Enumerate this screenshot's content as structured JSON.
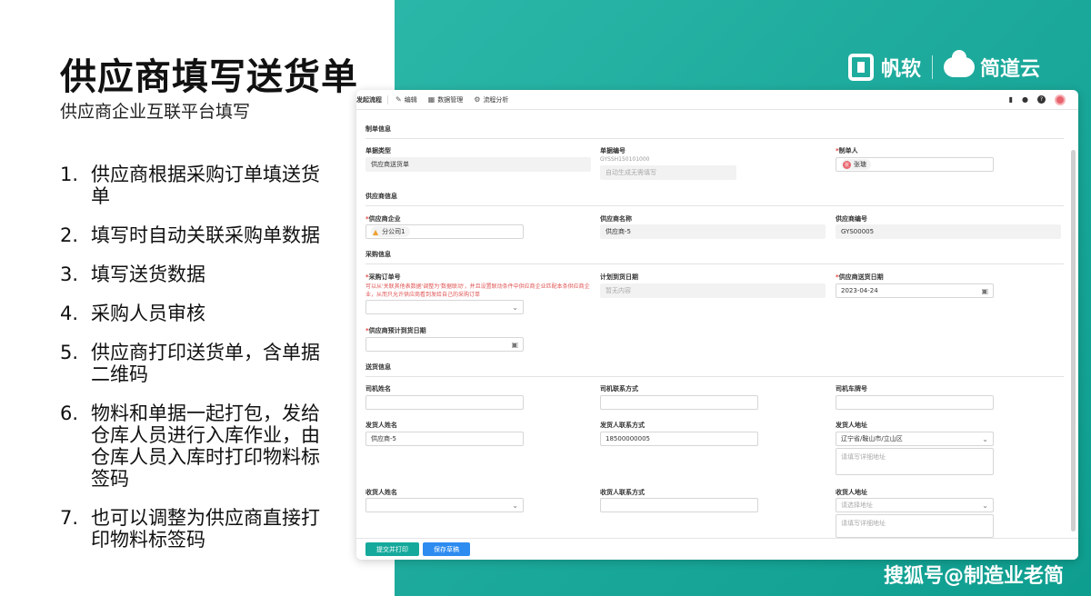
{
  "slide": {
    "title": "供应商填写送货单",
    "subtitle": "供应商企业互联平台填写",
    "steps": [
      {
        "num": "1.",
        "text": "供应商根据采购订单填送货单"
      },
      {
        "num": "2.",
        "text": "填写时自动关联采购单数据"
      },
      {
        "num": "3.",
        "text": "填写送货数据"
      },
      {
        "num": "4.",
        "text": "采购人员审核"
      },
      {
        "num": "5.",
        "text": "供应商打印送货单，含单据二维码"
      },
      {
        "num": "6.",
        "text": "物料和单据一起打包，发给仓库人员进行入库作业，由仓库人员入库时打印物料标签码"
      },
      {
        "num": "7.",
        "text": "也可以调整为供应商直接打印物料标签码"
      }
    ]
  },
  "brand": {
    "name1": "帆软",
    "name2": "简道云"
  },
  "watermark": "搜狐号@制造业老简",
  "toolbar": {
    "items": [
      "发起流程",
      "编辑",
      "数据管理",
      "流程分析"
    ],
    "help": "?"
  },
  "form": {
    "sections": {
      "doc": "制单信息",
      "supplier": "供应商信息",
      "purchase": "采购信息",
      "delivery": "送货信息"
    },
    "doc_type": {
      "label": "单据类型",
      "value": "供应商送货单"
    },
    "doc_no": {
      "label": "单据编号",
      "code": "GYSSH150101000",
      "placeholder": "自动生成无需填写"
    },
    "creator": {
      "label": "制单人",
      "value": "张瑭",
      "avatar": "张"
    },
    "supplier_company": {
      "label": "供应商企业",
      "value": "分公司1"
    },
    "supplier_name": {
      "label": "供应商名称",
      "value": "供应商-5"
    },
    "supplier_code": {
      "label": "供应商编号",
      "value": "GYS00005"
    },
    "po_no": {
      "label": "采购订单号",
      "hint1": "可以从'关联其他表数据'调整为'数据联动'，并且设置联动条件中供应商企业匹配本条供应商企",
      "hint2": "业，从而只允许供应商看到发给自己的采购订单"
    },
    "plan_date": {
      "label": "计划到货日期",
      "placeholder": "暂无内容"
    },
    "ship_date": {
      "label": "供应商送货日期",
      "value": "2023-04-24"
    },
    "expected_date": {
      "label": "供应商预计到货日期"
    },
    "driver_name": {
      "label": "司机姓名"
    },
    "driver_contact": {
      "label": "司机联系方式"
    },
    "plate_no": {
      "label": "司机车牌号"
    },
    "sender_name": {
      "label": "发货人姓名",
      "value": "供应商-5"
    },
    "sender_contact": {
      "label": "发货人联系方式",
      "value": "18500000005"
    },
    "sender_address": {
      "label": "发货人地址",
      "value": "辽宁省/鞍山市/立山区",
      "detail_placeholder": "请填写详细地址"
    },
    "receiver_name": {
      "label": "收货人姓名"
    },
    "receiver_contact": {
      "label": "收货人联系方式"
    },
    "receiver_address": {
      "label": "收货人地址",
      "placeholder": "请选择地址",
      "detail_placeholder": "请填写详细地址"
    }
  },
  "footer": {
    "submit_print": "提交并打印",
    "save_draft": "保存草稿"
  }
}
